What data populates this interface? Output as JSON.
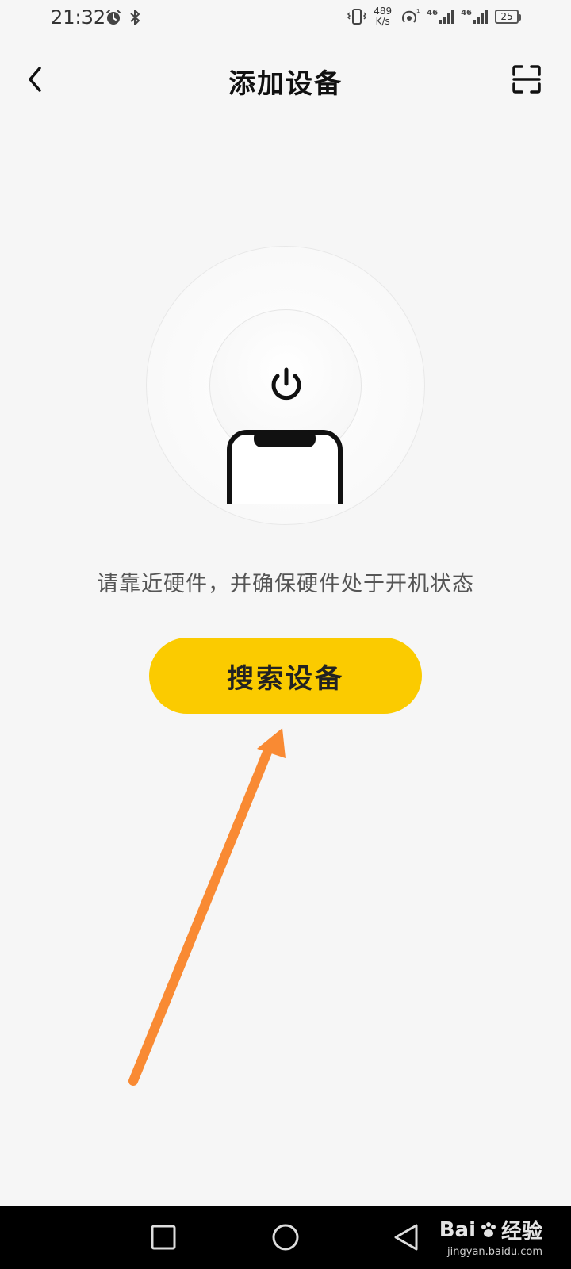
{
  "status_bar": {
    "time": "21:32",
    "left_icons": [
      "alarm-icon",
      "bluetooth-icon"
    ],
    "net_speed_value": "489",
    "net_speed_unit": "K/s",
    "signal1_label": "46",
    "signal2_label": "46",
    "battery": "25",
    "right_icons": [
      "vibrate-icon",
      "hotspot-icon",
      "signal-icon",
      "signal-icon",
      "battery-icon"
    ]
  },
  "header": {
    "title": "添加设备",
    "back_icon": "chevron-left-icon",
    "scan_icon": "scan-icon"
  },
  "main": {
    "illustration_icons": [
      "power-icon",
      "phone-icon"
    ],
    "instruction": "请靠近硬件，并确保硬件处于开机状态",
    "search_button_label": "搜索设备"
  },
  "annotation": {
    "arrow_color": "#f98a33"
  },
  "navigation": {
    "icons": [
      "square-icon",
      "circle-icon",
      "triangle-back-icon"
    ]
  },
  "watermark": {
    "brand": "Bai",
    "brand_cn": "经验",
    "url": "jingyan.baidu.com"
  },
  "colors": {
    "accent": "#fbcb00",
    "background": "#f6f6f6",
    "nav_bar": "#000000"
  }
}
